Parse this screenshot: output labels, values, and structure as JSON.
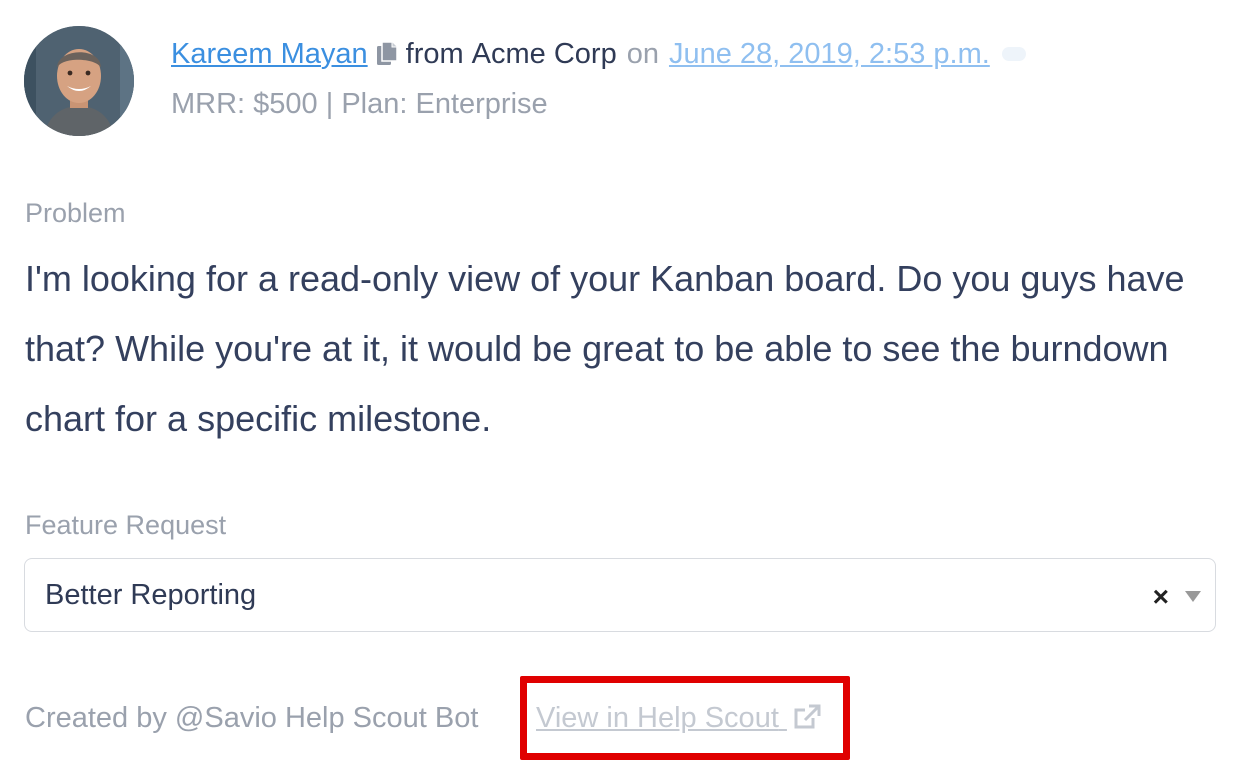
{
  "header": {
    "author_name": "Kareem Mayan",
    "from_word": "from",
    "company": "Acme Corp",
    "on_word": "on",
    "date": "June 28, 2019, 2:53 p.m.",
    "meta": "MRR: $500 | Plan: Enterprise"
  },
  "problem": {
    "label": "Problem",
    "text": "I'm looking for a read-only view of your Kanban board. Do you guys have that? While you're at it, it would be great to be able to see the burndown chart for a specific milestone."
  },
  "feature_request": {
    "label": "Feature Request",
    "selected_value": "Better Reporting",
    "clear_symbol": "×"
  },
  "footer": {
    "created_by": "Created by @Savio Help Scout Bot",
    "view_link": "View in Help Scout"
  },
  "icons": {
    "copy": "copy-icon",
    "external_link": "external-link-icon",
    "dropdown": "chevron-down-icon"
  },
  "colors": {
    "link": "#3b8fe0",
    "highlight": "#e00000",
    "text_dark": "#34405e",
    "text_muted": "#9aa1ad"
  }
}
